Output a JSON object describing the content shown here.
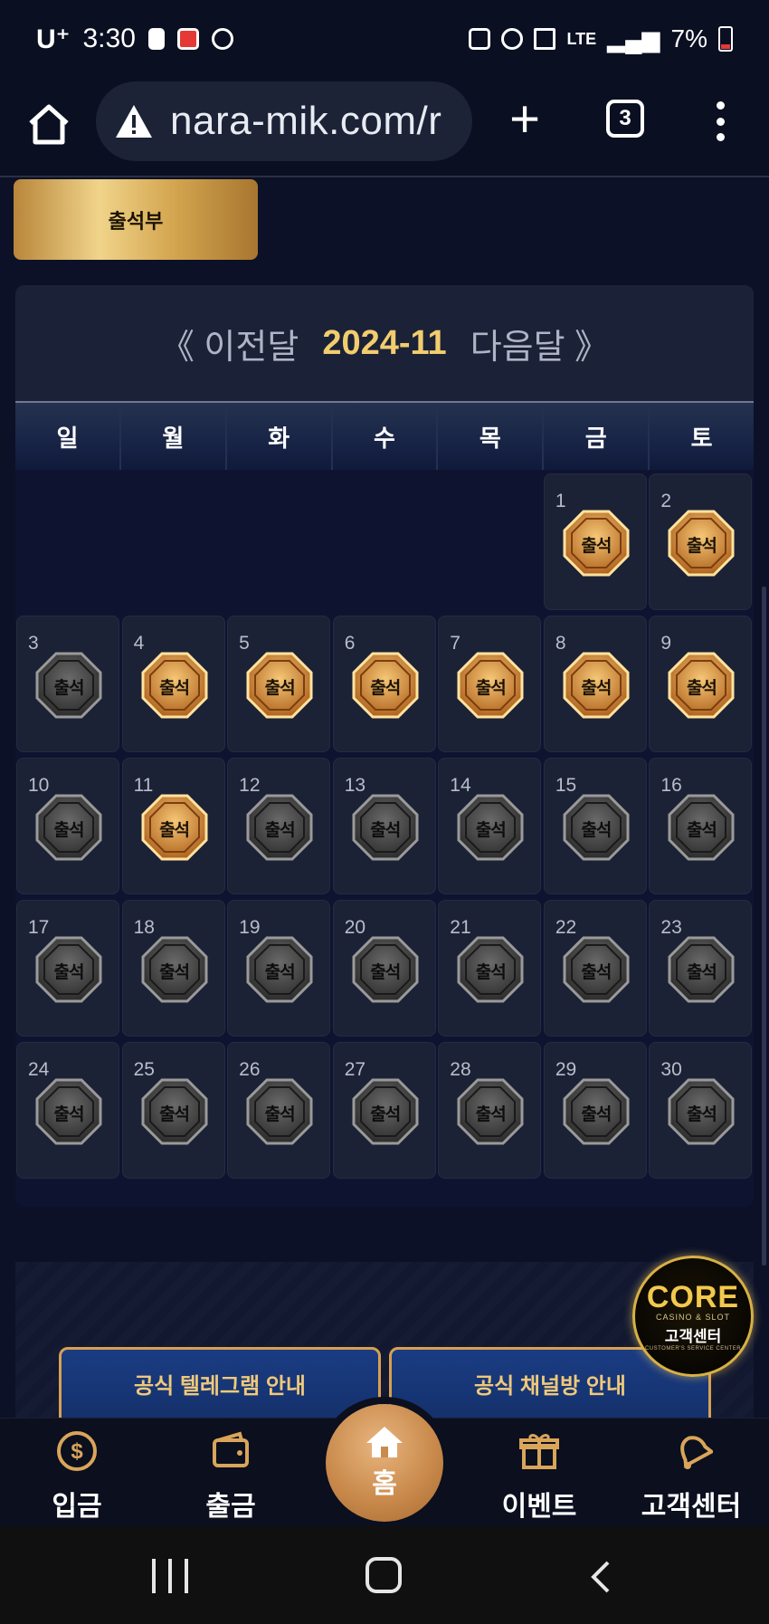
{
  "status_bar": {
    "carrier": "U⁺",
    "time": "3:30",
    "network": "LTE",
    "battery": "7%"
  },
  "browser": {
    "url": "nara-mik.com/r",
    "tab_count": "3"
  },
  "page": {
    "attendance_tab": "출석부",
    "calendar": {
      "prev_label": "《 이전달",
      "month_label": "2024-11",
      "next_label": "다음달 》",
      "weekdays": [
        "일",
        "월",
        "화",
        "수",
        "목",
        "금",
        "토"
      ],
      "stamp_label": "출석",
      "first_weekday_index": 5,
      "days": [
        {
          "day": "1",
          "attended": true
        },
        {
          "day": "2",
          "attended": true
        },
        {
          "day": "3",
          "attended": false
        },
        {
          "day": "4",
          "attended": true
        },
        {
          "day": "5",
          "attended": true
        },
        {
          "day": "6",
          "attended": true
        },
        {
          "day": "7",
          "attended": true
        },
        {
          "day": "8",
          "attended": true
        },
        {
          "day": "9",
          "attended": true
        },
        {
          "day": "10",
          "attended": false
        },
        {
          "day": "11",
          "attended": true
        },
        {
          "day": "12",
          "attended": false
        },
        {
          "day": "13",
          "attended": false
        },
        {
          "day": "14",
          "attended": false
        },
        {
          "day": "15",
          "attended": false
        },
        {
          "day": "16",
          "attended": false
        },
        {
          "day": "17",
          "attended": false
        },
        {
          "day": "18",
          "attended": false
        },
        {
          "day": "19",
          "attended": false
        },
        {
          "day": "20",
          "attended": false
        },
        {
          "day": "21",
          "attended": false
        },
        {
          "day": "22",
          "attended": false
        },
        {
          "day": "23",
          "attended": false
        },
        {
          "day": "24",
          "attended": false
        },
        {
          "day": "25",
          "attended": false
        },
        {
          "day": "26",
          "attended": false
        },
        {
          "day": "27",
          "attended": false
        },
        {
          "day": "28",
          "attended": false
        },
        {
          "day": "29",
          "attended": false
        },
        {
          "day": "30",
          "attended": false
        }
      ]
    },
    "telegram_button": "공식 텔레그램 안내",
    "channel_button": "공식 채널방 안내",
    "support_badge": {
      "brand": "CORE",
      "tagline": "CASINO & SLOT",
      "title": "고객센터",
      "subtitle": "CUSTOMER'S SERVICE CENTER"
    }
  },
  "bottom_nav": {
    "deposit": "입금",
    "withdraw": "출금",
    "home": "홈",
    "event": "이벤트",
    "support": "고객센터"
  },
  "colors": {
    "accent_gold": "#f2cd6e",
    "background": "#0c1128",
    "cell": "#1c2236"
  }
}
